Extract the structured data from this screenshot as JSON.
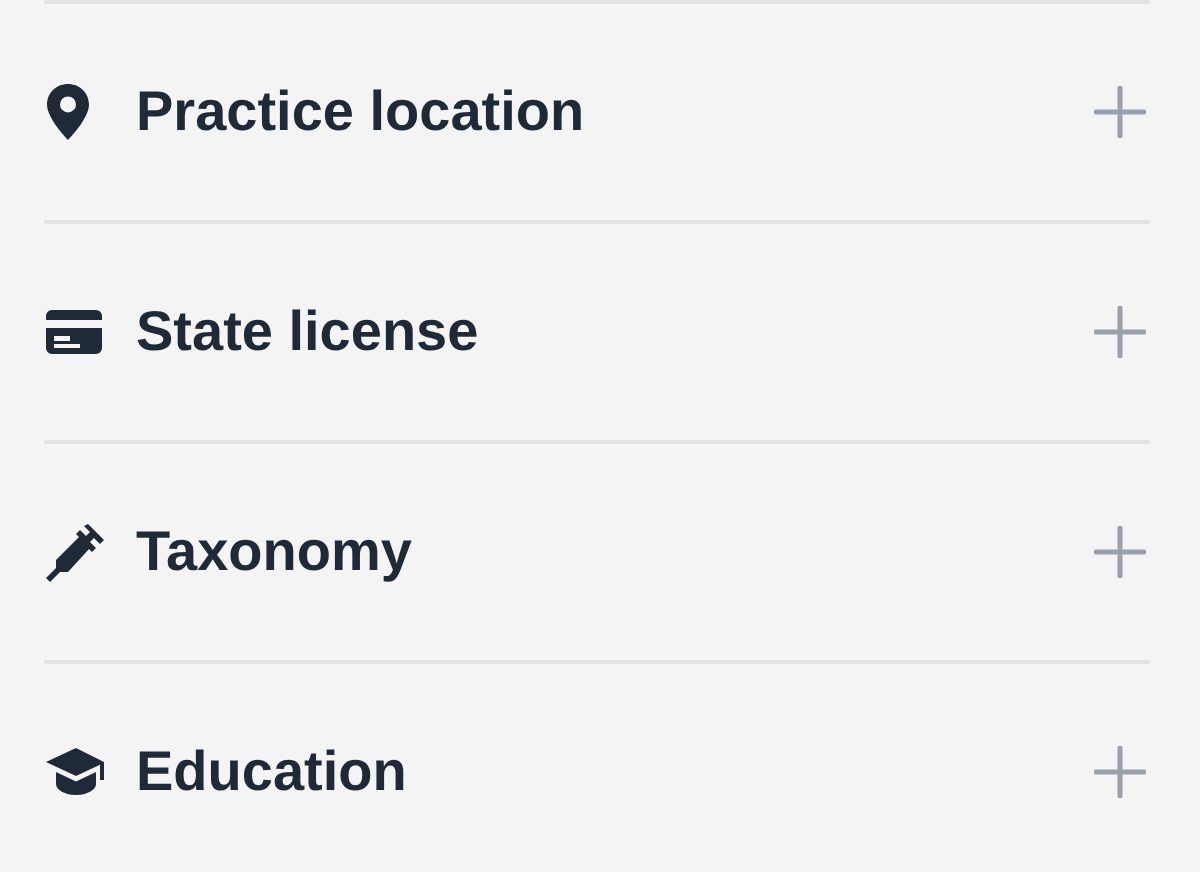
{
  "sections": [
    {
      "title": "Practice location",
      "kind": "location",
      "expanded": false
    },
    {
      "title": "State license",
      "kind": "license",
      "expanded": false
    },
    {
      "title": "Taxonomy",
      "kind": "taxonomy",
      "expanded": false
    },
    {
      "title": "Education",
      "kind": "education",
      "expanded": false
    }
  ]
}
